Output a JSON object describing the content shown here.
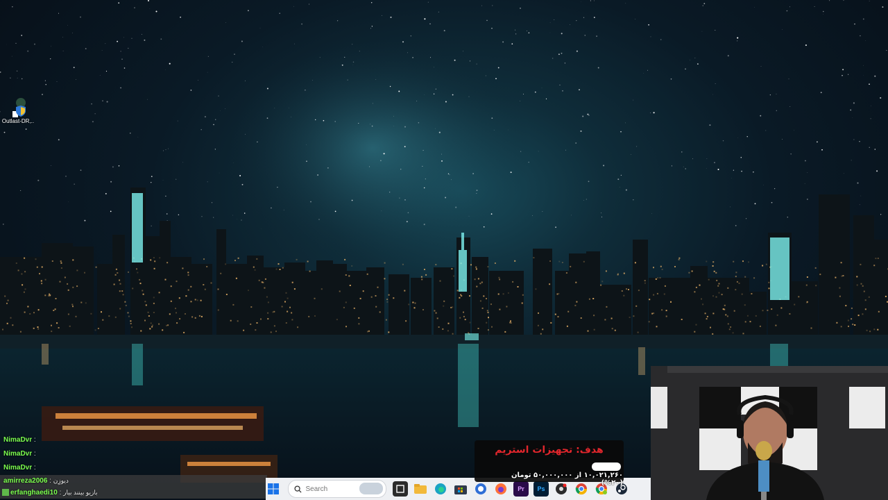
{
  "desktop": {
    "icons": [
      {
        "label": "Outlast-DR..."
      }
    ]
  },
  "chat": {
    "messages": [
      {
        "user": "NimaDvr",
        "text": ""
      },
      {
        "user": "NimaDvr",
        "text": ""
      },
      {
        "user": "NimaDvr",
        "text": ""
      },
      {
        "user": "amirreza2006",
        "text": "دیوزِن"
      },
      {
        "user": "erfanghaedi10",
        "text": "بازیو بینند بیار"
      }
    ]
  },
  "taskbar": {
    "search_placeholder": "Search",
    "apps": [
      "windows-start",
      "search",
      "widgets",
      "task-view",
      "file-explorer",
      "edge",
      "microsoft-store",
      "phone-link",
      "firefox",
      "premiere-pro",
      "photoshop",
      "obs",
      "chrome",
      "chrome-profile",
      "steam"
    ],
    "labels": {
      "premiere": "Pr",
      "photoshop": "Ps"
    }
  },
  "goal_widget": {
    "title": "هدف: تجهیزات استریم",
    "progress_text": "۱۰,۰۲۱,۲۶۰ از ۵۰,۰۰۰,۰۰۰ تومان (۲۰%)",
    "progress_fraction": 0.2,
    "accent": "#e2262c"
  },
  "webcam": {
    "present": true
  }
}
